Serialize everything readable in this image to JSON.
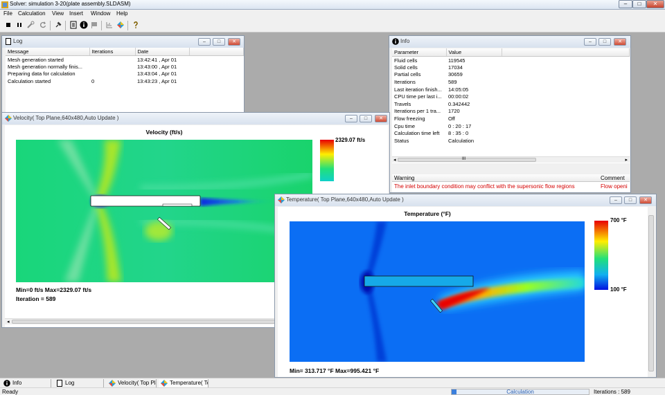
{
  "app": {
    "title": "Solver: simulation 3-20(plate assembly.SLDASM)",
    "window_controls": [
      "–",
      "□",
      "✕"
    ]
  },
  "menu": [
    "File",
    "Calculation",
    "View",
    "Insert",
    "Window",
    "Help"
  ],
  "toolbar": {
    "icons": [
      "stop-icon",
      "pause-icon",
      "wrench-icon",
      "refresh-icon",
      "pin-icon",
      "document-icon",
      "info-icon",
      "flag-icon",
      "chart-icon",
      "flow-icon",
      "help-icon"
    ]
  },
  "log": {
    "title": "Log",
    "columns": [
      "Message",
      "Iterations",
      "Date"
    ],
    "rows": [
      [
        "Mesh generation started",
        "",
        "13:42:41 , Apr 01"
      ],
      [
        "Mesh generation normally finis...",
        "",
        "13:43:00 , Apr 01"
      ],
      [
        "Preparing data for calculation",
        "",
        "13:43:04 , Apr 01"
      ],
      [
        "Calculation started",
        "0",
        "13:43:23 , Apr 01"
      ]
    ]
  },
  "info": {
    "title": "Info",
    "columns": [
      "Parameter",
      "Value"
    ],
    "rows": [
      [
        "Fluid cells",
        "119545"
      ],
      [
        "Solid cells",
        "17034"
      ],
      [
        "Partial cells",
        "30659"
      ],
      [
        "Iterations",
        "589"
      ],
      [
        "Last iteration finish...",
        "14:05:05"
      ],
      [
        "CPU time per last i...",
        "00:00:02"
      ],
      [
        "Travels",
        "0.342442"
      ],
      [
        "Iterations per 1 tra...",
        "1720"
      ],
      [
        "Flow freezing",
        "Off"
      ],
      [
        "Cpu time",
        "0 : 20 : 17"
      ],
      [
        "Calculation time left",
        "8 : 35 : 0"
      ],
      [
        "Status",
        "Calculation"
      ]
    ],
    "scroll_grip": "III",
    "warning_columns": [
      "Warning",
      "Comment"
    ],
    "warning_text": "The inlet boundary condition may conflict with the supersonic flow regions",
    "warning_comment": "Flow openi",
    "warning_color": "#d40000"
  },
  "velocity": {
    "title": "Velocity( Top Plane,640x480,Auto Update )",
    "plot_title": "Velocity (ft/s)",
    "legend_max": "2329.07 ft/s",
    "min_max": "Min=0 ft/s   Max=2329.07 ft/s",
    "iteration": "Iteration = 589"
  },
  "temperature": {
    "title": "Temperature( Top Plane,640x480,Auto Update )",
    "plot_title": "Temperature (°F)",
    "legend_max": "700 °F",
    "legend_min": "100 °F",
    "min_max": "Min= 313.717 °F   Max=995.421 °F"
  },
  "taskbar": [
    {
      "label": "Info",
      "icon": "info-icon"
    },
    {
      "label": "Log",
      "icon": "document-icon"
    },
    {
      "label": "Velocity( Top Pla",
      "icon": "flow-icon"
    },
    {
      "label": "Temperature( To",
      "icon": "flow-icon"
    }
  ],
  "status": {
    "left": "Ready",
    "progress_label": "Calculation",
    "iterations": "Iterations : 589"
  }
}
